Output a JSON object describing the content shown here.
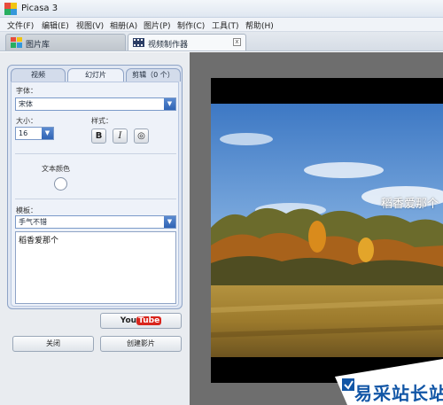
{
  "app": {
    "title": "Picasa 3"
  },
  "menu": [
    "文件(F)",
    "编辑(E)",
    "视图(V)",
    "相册(A)",
    "图片(P)",
    "制作(C)",
    "工具(T)",
    "帮助(H)"
  ],
  "tabs": {
    "library": "图片库",
    "movie_maker": "视频制作器",
    "close": "x"
  },
  "subtabs": {
    "video": "视频",
    "slideshow": "幻灯片",
    "clips": "剪辑（0 个）"
  },
  "form": {
    "font_label": "字体：",
    "font_value": "宋体",
    "size_label": "大小：",
    "size_value": "16",
    "style_label": "样式：",
    "bold": "B",
    "italic": "I",
    "outline": "◎",
    "text_color_label": "文本颜色",
    "template_label": "模板：",
    "template_value": "手气不错",
    "text_content": "稻香爱那个"
  },
  "buttons": {
    "youtube_you": "You",
    "youtube_tube": "Tube",
    "close": "关闭",
    "create_movie": "创建影片"
  },
  "preview": {
    "overlay_text": "稻香爱那个"
  },
  "watermark": {
    "text": "易采站长站",
    "url": "jb51.net"
  }
}
